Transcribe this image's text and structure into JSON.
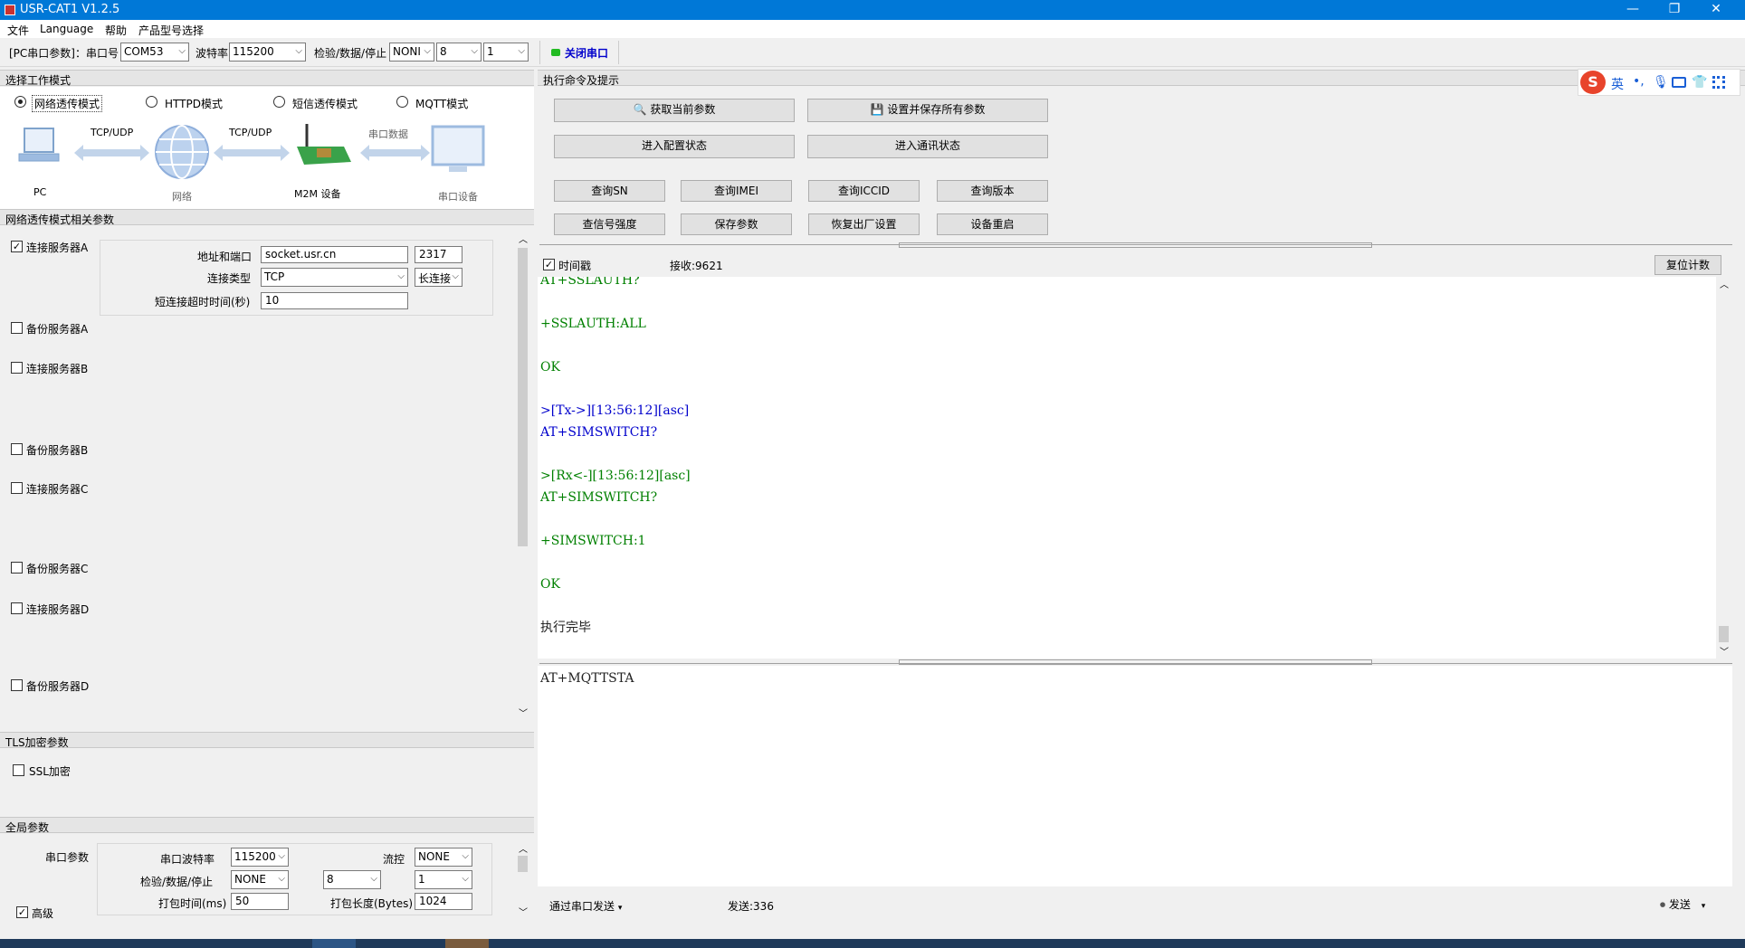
{
  "window": {
    "title": "USR-CAT1 V1.2.5",
    "controls": {
      "minimize": "—",
      "restore": "❐",
      "close": "✕"
    }
  },
  "menu": [
    "文件",
    "Language",
    "帮助",
    "产品型号选择"
  ],
  "toolbar": {
    "pc_params_label": "[PC串口参数]：串口号",
    "com_port": "COM53",
    "baud_label": "波特率",
    "baud": "115200",
    "check_label": "检验/数据/停止",
    "parity": "NONI",
    "data_bits": "8",
    "stop_bits": "1",
    "close_port": "关闭串口",
    "port_status_color": "#22bb22"
  },
  "left": {
    "work_mode_header": "选择工作模式",
    "modes": [
      "网络透传模式",
      "HTTPD模式",
      "短信透传模式",
      "MQTT模式"
    ],
    "selected_mode": "网络透传模式",
    "diagram": {
      "pc": "PC",
      "link1": "TCP/UDP",
      "network": "网络",
      "link2": "TCP/UDP",
      "m2m": "M2M 设备",
      "link3": "串口数据",
      "serial_device": "串口设备"
    },
    "net_params_header": "网络透传模式相关参数",
    "servers": [
      {
        "label": "连接服务器A",
        "checked": true
      },
      {
        "label": "备份服务器A",
        "checked": false
      },
      {
        "label": "连接服务器B",
        "checked": false
      },
      {
        "label": "备份服务器B",
        "checked": false
      },
      {
        "label": "连接服务器C",
        "checked": false
      },
      {
        "label": "备份服务器C",
        "checked": false
      },
      {
        "label": "连接服务器D",
        "checked": false
      },
      {
        "label": "备份服务器D",
        "checked": false
      }
    ],
    "server_a": {
      "addr_label": "地址和端口",
      "address": "socket.usr.cn",
      "port": "2317",
      "conn_type_label": "连接类型",
      "conn_type": "TCP",
      "conn_mode": "长连接",
      "timeout_label": "短连接超时时间(秒)",
      "timeout": "10"
    },
    "tls_header": "TLS加密参数",
    "ssl_label": "SSL加密",
    "global_header": "全局参数",
    "serial_params_label": "串口参数",
    "global": {
      "baud_label": "串口波特率",
      "baud": "115200",
      "flow_label": "流控",
      "flow": "NONE",
      "check_label": "检验/数据/停止",
      "parity": "NONE",
      "data_bits": "8",
      "stop_bits": "1",
      "pack_time_label": "打包时间(ms)",
      "pack_time": "50",
      "pack_len_label": "打包长度(Bytes)",
      "pack_len": "1024",
      "advanced_label": "高级"
    }
  },
  "right": {
    "header": "执行命令及提示",
    "buttons": {
      "get_params": "获取当前参数",
      "save_params": "设置并保存所有参数",
      "enter_config": "进入配置状态",
      "enter_comm": "进入通讯状态",
      "query_sn": "查询SN",
      "query_imei": "查询IMEI",
      "query_iccid": "查询ICCID",
      "query_version": "查询版本",
      "query_signal": "查信号强度",
      "save_param": "保存参数",
      "factory_reset": "恢复出厂设置",
      "reboot": "设备重启"
    },
    "timestamp_label": "时间戳",
    "recv_count": "接收:9621",
    "reset_count": "复位计数",
    "log": [
      {
        "text": "AT+SSLAUTH?",
        "cls": "green"
      },
      {
        "text": "",
        "cls": ""
      },
      {
        "text": "+SSLAUTH:ALL",
        "cls": "green"
      },
      {
        "text": "",
        "cls": ""
      },
      {
        "text": "OK",
        "cls": "green"
      },
      {
        "text": "",
        "cls": ""
      },
      {
        "text": ">[Tx->][13:56:12][asc]",
        "cls": "blue"
      },
      {
        "text": "AT+SIMSWITCH?",
        "cls": "blue"
      },
      {
        "text": "",
        "cls": ""
      },
      {
        "text": ">[Rx<-][13:56:12][asc]",
        "cls": "green"
      },
      {
        "text": "AT+SIMSWITCH?",
        "cls": "green"
      },
      {
        "text": "",
        "cls": ""
      },
      {
        "text": "+SIMSWITCH:1",
        "cls": "green"
      },
      {
        "text": "",
        "cls": ""
      },
      {
        "text": "OK",
        "cls": "green"
      },
      {
        "text": "",
        "cls": ""
      },
      {
        "text": "执行完毕",
        "cls": ""
      }
    ],
    "send_text": "AT+MQTTSTA",
    "send_via": "通过串口发送",
    "send_count": "发送:336",
    "send_button": "发送"
  },
  "ime": {
    "mode": "英",
    "punct": "•,"
  }
}
